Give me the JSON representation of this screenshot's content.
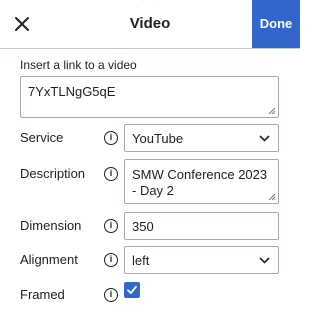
{
  "header": {
    "title": "Video",
    "done_label": "Done"
  },
  "link": {
    "label": "Insert a link to a video",
    "value": "7YxTLNgG5qE"
  },
  "info_glyph": "i",
  "rows": {
    "service": {
      "label": "Service",
      "value": "YouTube"
    },
    "description": {
      "label": "Description",
      "value": "SMW Conference 2023 - Day 2"
    },
    "dimension": {
      "label": "Dimension",
      "value": "350"
    },
    "alignment": {
      "label": "Alignment",
      "value": "left"
    },
    "framed": {
      "label": "Framed",
      "checked": true
    }
  },
  "colors": {
    "accent": "#3366cc",
    "border": "#a2a9b1",
    "text": "#202122"
  },
  "icons": {
    "close": "close-icon",
    "info": "info-icon",
    "dropdown": "chevron-down-icon",
    "check": "checkmark-icon"
  }
}
